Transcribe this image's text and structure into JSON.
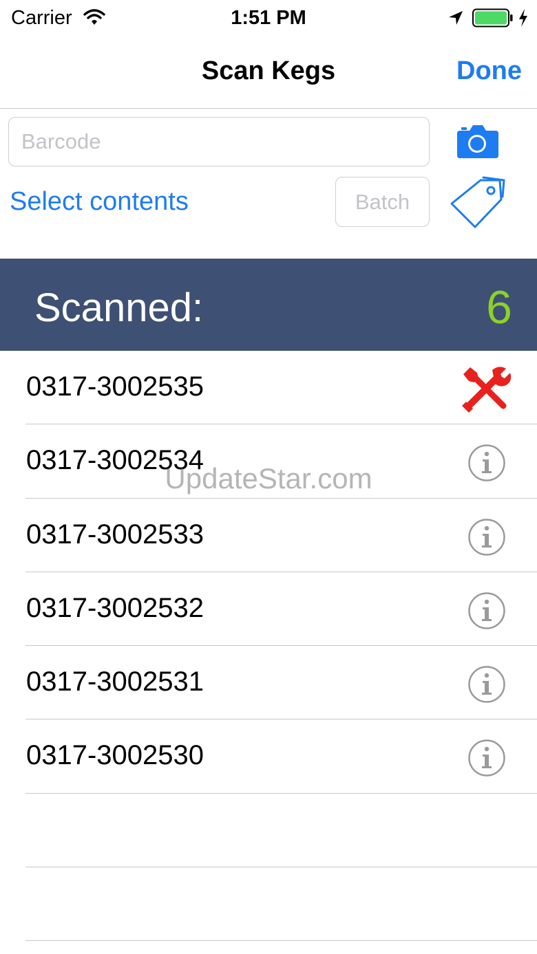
{
  "status_bar": {
    "carrier": "Carrier",
    "time": "1:51 PM",
    "battery_color": "#4cd964"
  },
  "nav": {
    "title": "Scan Kegs",
    "done_label": "Done"
  },
  "form": {
    "barcode_placeholder": "Barcode",
    "select_contents_label": "Select contents",
    "batch_placeholder": "Batch"
  },
  "summary": {
    "label": "Scanned:",
    "count": "6"
  },
  "kegs": [
    {
      "code": "0317-3002535",
      "icon": "repair-tools-icon"
    },
    {
      "code": "0317-3002534",
      "icon": "info-icon"
    },
    {
      "code": "0317-3002533",
      "icon": "info-icon"
    },
    {
      "code": "0317-3002532",
      "icon": "info-icon"
    },
    {
      "code": "0317-3002531",
      "icon": "info-icon"
    },
    {
      "code": "0317-3002530",
      "icon": "info-icon"
    }
  ],
  "watermark": "UpdateStar.com",
  "colors": {
    "accent": "#1e7cf2",
    "banner": "#3e5073",
    "count": "#8bd129",
    "alert": "#e8211e"
  }
}
